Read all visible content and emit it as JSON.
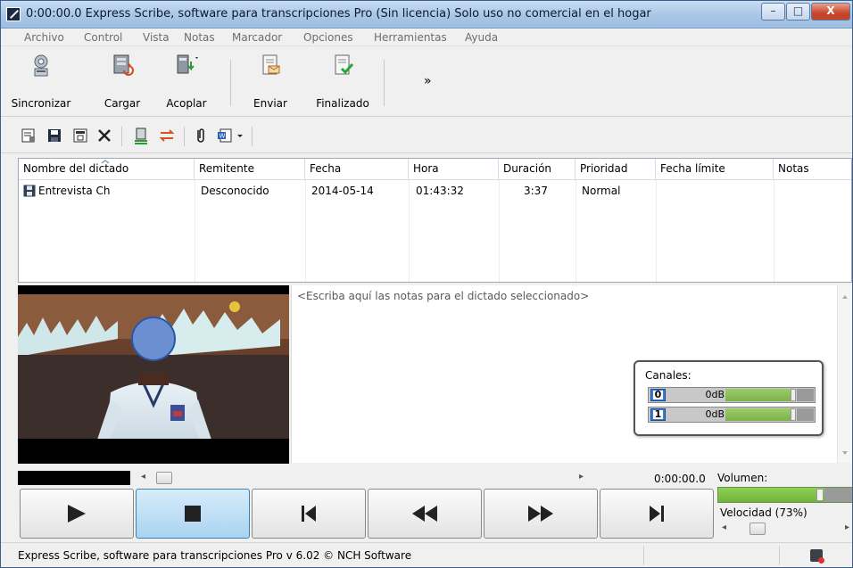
{
  "window": {
    "title": "0:00:00.0 Express Scribe, software para transcripciones Pro (Sin licencia) Solo uso no comercial en el hogar",
    "minimize_glyph": "–",
    "maximize_glyph": "□",
    "close_glyph": "X"
  },
  "menu": [
    "Archivo",
    "Control",
    "Vista",
    "Notas",
    "Marcador",
    "Opciones",
    "Herramientas",
    "Ayuda"
  ],
  "toolbar": {
    "sync_label": "Sincronizar",
    "load_label": "Cargar",
    "dock_label": "Acoplar",
    "send_label": "Enviar",
    "done_label": "Finalizado",
    "more_glyph": "»"
  },
  "list": {
    "columns": [
      "Nombre del dictado",
      "Remitente",
      "Fecha",
      "Hora",
      "Duración",
      "Prioridad",
      "Fecha límite",
      "Notas"
    ],
    "rows": [
      {
        "name": "Entrevista Ch",
        "sender": "Desconocido",
        "date": "2014-05-14",
        "time": "01:43:32",
        "duration": "3:37",
        "priority": "Normal",
        "due": "",
        "notes": ""
      }
    ]
  },
  "notes": {
    "placeholder": "<Escriba aquí las notas para el dictado seleccionado>"
  },
  "channels": {
    "title": "Canales:",
    "items": [
      {
        "num": "0",
        "db": "0dB",
        "level": 0.85
      },
      {
        "num": "1",
        "db": "0dB",
        "level": 0.85
      }
    ]
  },
  "playback": {
    "time": "0:00:00.0",
    "volume_label": "Volumen:",
    "volume_level": 0.78,
    "speed_label": "Velocidad (73%)",
    "speed_percent": 73
  },
  "status": {
    "text": "Express Scribe, software para transcripciones Pro v 6.02 © NCH Software"
  },
  "colors": {
    "titlebar": "#a9c6e6",
    "level_green": "#7db24a",
    "active_button": "#a9d3f1",
    "close_red": "#c7452a"
  }
}
